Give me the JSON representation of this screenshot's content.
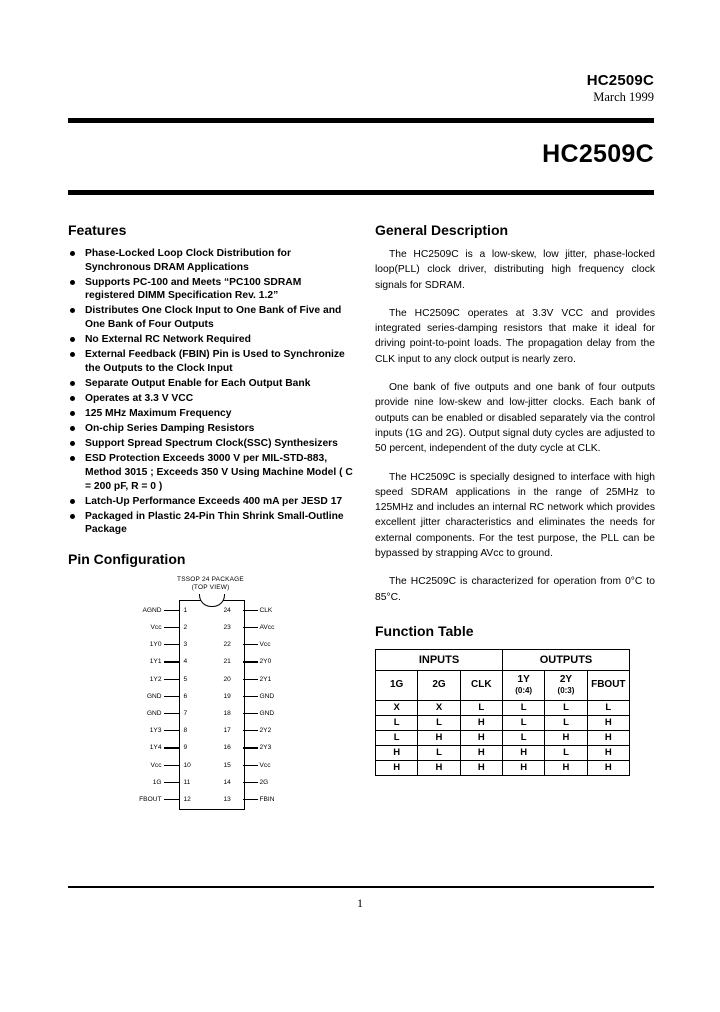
{
  "header": {
    "part_number": "HC2509C",
    "date": "March 1999",
    "title": "HC2509C"
  },
  "features": {
    "heading": "Features",
    "items": [
      "Phase-Locked Loop Clock Distribution for Synchronous DRAM Applications",
      "Supports PC-100 and Meets “PC100 SDRAM registered DIMM Specification Rev. 1.2”",
      "Distributes One Clock Input to One Bank of Five and One Bank of Four Outputs",
      "No External RC Network Required",
      "External Feedback (FBIN) Pin is Used to Synchronize the Outputs to the Clock Input",
      "Separate Output Enable for Each Output Bank",
      "Operates at 3.3 V VCC",
      "125 MHz Maximum Frequency",
      "On-chip Series Damping Resistors",
      "Support Spread Spectrum Clock(SSC) Synthesizers",
      "ESD Protection Exceeds 3000 V per MIL-STD-883, Method 3015 ; Exceeds 350 V Using Machine     Model ( C = 200 pF, R = 0 )",
      "Latch-Up Performance Exceeds 400 mA per JESD 17",
      "Packaged in Plastic 24-Pin Thin Shrink Small-Outline Package"
    ]
  },
  "pin_configuration": {
    "heading": "Pin Configuration",
    "package_caption_line1": "TSSOP 24 PACKAGE",
    "package_caption_line2": "(TOP VIEW)",
    "left_pins": [
      {
        "num": "1",
        "name": "AGND"
      },
      {
        "num": "2",
        "name": "Vcc"
      },
      {
        "num": "3",
        "name": "1Y0"
      },
      {
        "num": "4",
        "name": "1Y1"
      },
      {
        "num": "5",
        "name": "1Y2"
      },
      {
        "num": "6",
        "name": "GND"
      },
      {
        "num": "7",
        "name": "GND"
      },
      {
        "num": "8",
        "name": "1Y3"
      },
      {
        "num": "9",
        "name": "1Y4"
      },
      {
        "num": "10",
        "name": "Vcc"
      },
      {
        "num": "11",
        "name": "1G"
      },
      {
        "num": "12",
        "name": "FBOUT"
      }
    ],
    "right_pins": [
      {
        "num": "24",
        "name": "CLK"
      },
      {
        "num": "23",
        "name": "AVcc"
      },
      {
        "num": "22",
        "name": "Vcc"
      },
      {
        "num": "21",
        "name": "2Y0"
      },
      {
        "num": "20",
        "name": "2Y1"
      },
      {
        "num": "19",
        "name": "GND"
      },
      {
        "num": "18",
        "name": "GND"
      },
      {
        "num": "17",
        "name": "2Y2"
      },
      {
        "num": "16",
        "name": "2Y3"
      },
      {
        "num": "15",
        "name": "Vcc"
      },
      {
        "num": "14",
        "name": "2G"
      },
      {
        "num": "13",
        "name": "FBIN"
      }
    ]
  },
  "general_description": {
    "heading": "General Description",
    "paragraphs": [
      "The HC2509C is a low-skew, low jitter, phase-locked loop(PLL) clock driver, distributing high frequency clock signals for SDRAM.",
      "The HC2509C operates at 3.3V VCC and provides integrated series-damping resistors that make it ideal for driving point-to-point loads. The propagation delay from the CLK input to any clock output is nearly zero.",
      "One bank of five outputs and one bank of four outputs provide nine low-skew and low-jitter clocks. Each bank of outputs can be enabled or disabled separately via the control inputs (1G and 2G). Output signal duty cycles are adjusted to 50 percent, independent of the duty cycle at CLK.",
      "The HC2509C is specially designed to interface with high speed SDRAM applications in the range of 25MHz to 125MHz and includes an internal RC network which provides excellent jitter characteristics and eliminates the needs for external components. For the test purpose, the PLL can be bypassed by strapping AVcc to ground.",
      "The HC2509C is characterized for operation from 0°C to 85°C."
    ]
  },
  "function_table": {
    "heading": "Function Table",
    "group_headers": [
      "INPUTS",
      "OUTPUTS"
    ],
    "columns": [
      {
        "label": "1G",
        "sub": ""
      },
      {
        "label": "2G",
        "sub": ""
      },
      {
        "label": "CLK",
        "sub": ""
      },
      {
        "label": "1Y",
        "sub": "(0:4)"
      },
      {
        "label": "2Y",
        "sub": "(0:3)"
      },
      {
        "label": "FBOUT",
        "sub": ""
      }
    ],
    "rows": [
      [
        "X",
        "X",
        "L",
        "L",
        "L",
        "L"
      ],
      [
        "L",
        "L",
        "H",
        "L",
        "L",
        "H"
      ],
      [
        "L",
        "H",
        "H",
        "L",
        "H",
        "H"
      ],
      [
        "H",
        "L",
        "H",
        "H",
        "L",
        "H"
      ],
      [
        "H",
        "H",
        "H",
        "H",
        "H",
        "H"
      ]
    ]
  },
  "footer": {
    "page_number": "1"
  }
}
